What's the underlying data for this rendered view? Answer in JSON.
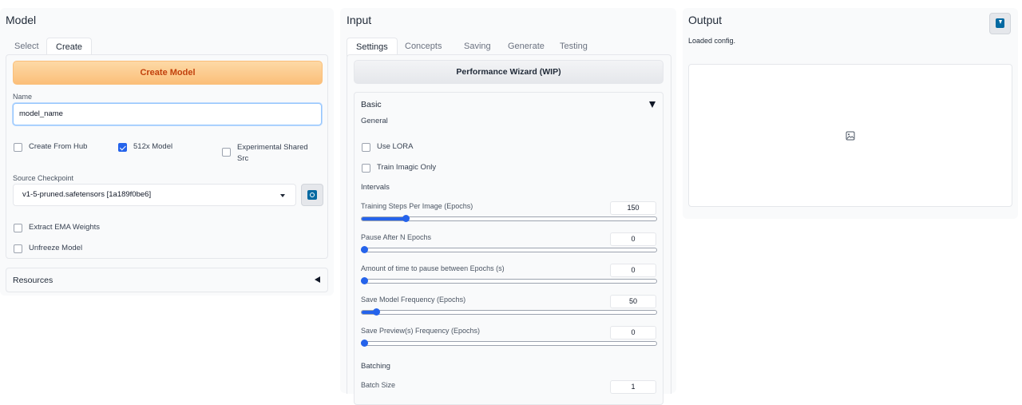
{
  "model": {
    "title": "Model",
    "tabs": [
      "Select",
      "Create"
    ],
    "create_button": "Create Model",
    "name_label": "Name",
    "name_value": "model_name",
    "create_from_hub": "Create From Hub",
    "model_512": "512x Model",
    "experimental_line1": "Experimental Shared",
    "experimental_line2": "Src",
    "source_checkpoint_label": "Source Checkpoint",
    "source_checkpoint_value": "v1-5-pruned.safetensors [1a189f0be6]",
    "extract_ema": "Extract EMA Weights",
    "unfreeze": "Unfreeze Model",
    "resources": "Resources"
  },
  "input": {
    "title": "Input",
    "tabs": [
      "Settings",
      "Concepts",
      "Saving",
      "Generate",
      "Testing"
    ],
    "wizard_button": "Performance Wizard (WIP)",
    "basic": "Basic",
    "general": "General",
    "use_lora": "Use LORA",
    "train_imagic": "Train Imagic Only",
    "intervals": "Intervals",
    "sliders": [
      {
        "label": "Training Steps Per Image (Epochs)",
        "value": "150",
        "fraction": 0.15
      },
      {
        "label": "Pause After N Epochs",
        "value": "0",
        "fraction": 0
      },
      {
        "label": "Amount of time to pause between Epochs (s)",
        "value": "0",
        "fraction": 0
      },
      {
        "label": "Save Model Frequency (Epochs)",
        "value": "50",
        "fraction": 0.05
      },
      {
        "label": "Save Preview(s) Frequency (Epochs)",
        "value": "0",
        "fraction": 0
      }
    ],
    "batching": "Batching",
    "batch_size_label": "Batch Size",
    "batch_size_value": "1"
  },
  "output": {
    "title": "Output",
    "status": "Loaded config."
  },
  "icons": {
    "refresh": "refresh-icon",
    "download": "download-icon",
    "image_placeholder": "image-icon"
  },
  "colors": {
    "accent": "#2563eb",
    "create_button_text": "#c2410c",
    "create_button_bg": "#fbbf7a"
  }
}
